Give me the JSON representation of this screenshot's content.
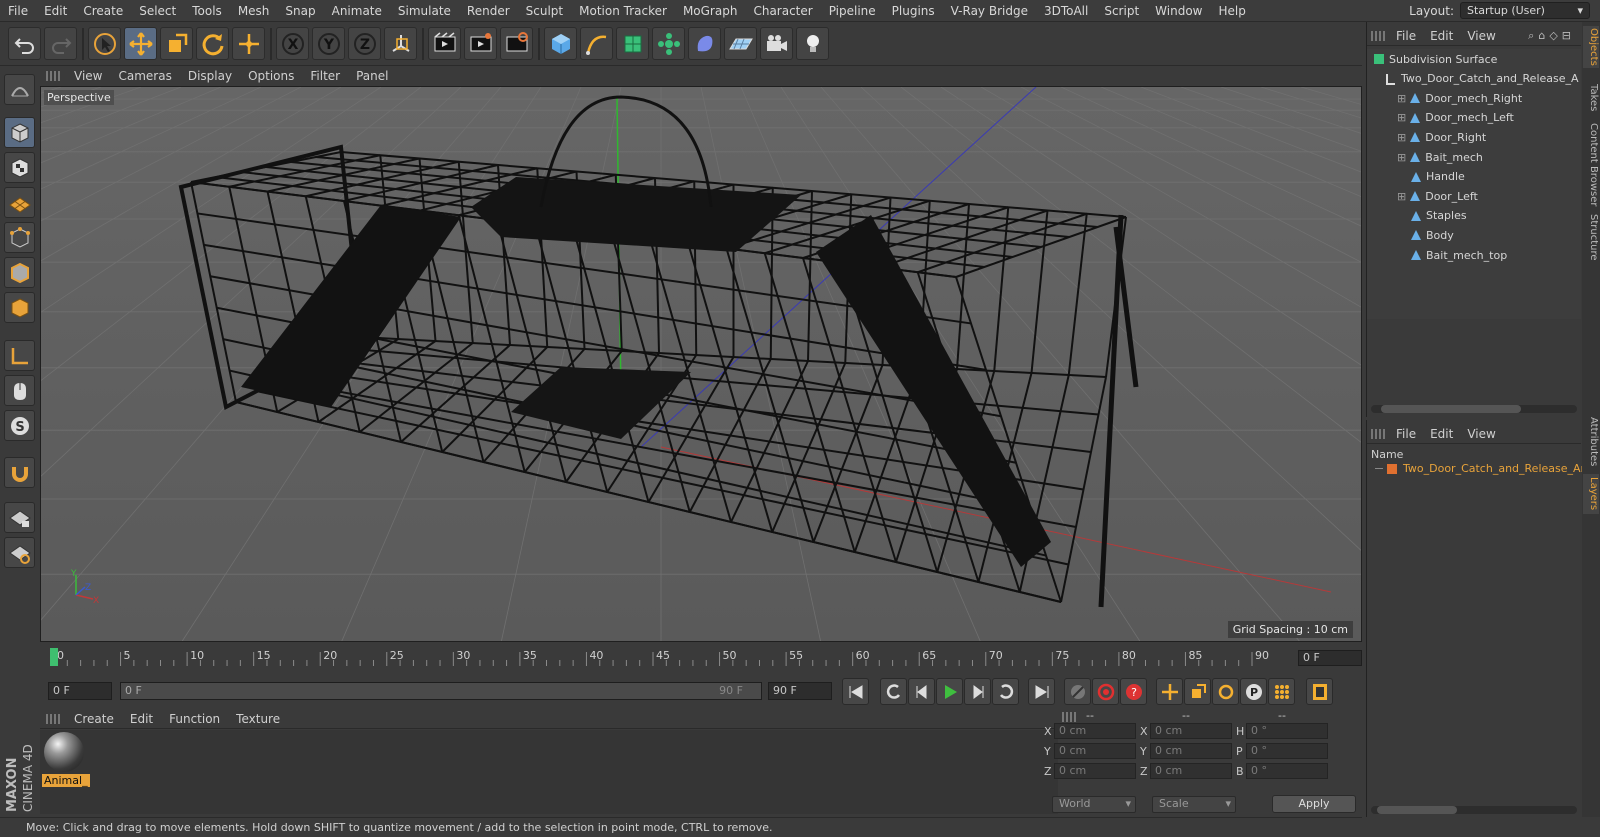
{
  "menubar": {
    "items": [
      "File",
      "Edit",
      "Create",
      "Select",
      "Tools",
      "Mesh",
      "Snap",
      "Animate",
      "Simulate",
      "Render",
      "Sculpt",
      "Motion Tracker",
      "MoGraph",
      "Character",
      "Pipeline",
      "Plugins",
      "V-Ray Bridge",
      "3DToAll",
      "Script",
      "Window",
      "Help"
    ],
    "layout_label": "Layout:",
    "layout_value": "Startup (User)"
  },
  "viewport": {
    "menu": [
      "View",
      "Cameras",
      "Display",
      "Options",
      "Filter",
      "Panel"
    ],
    "camera_label": "Perspective",
    "grid_spacing": "Grid Spacing : 10 cm",
    "axis_labels": [
      "Y",
      "Z",
      "X"
    ]
  },
  "timeline": {
    "ticks": [
      "0",
      "5",
      "10",
      "15",
      "20",
      "25",
      "30",
      "35",
      "40",
      "45",
      "50",
      "55",
      "60",
      "65",
      "70",
      "75",
      "80",
      "85",
      "90"
    ],
    "current_frame": "0 F"
  },
  "transport": {
    "start_field": "0 F",
    "range_start": "0 F",
    "range_end": "90 F",
    "end_field": "90 F"
  },
  "material_manager": {
    "menu": [
      "Create",
      "Edit",
      "Function",
      "Texture"
    ],
    "material_name": "Animal_"
  },
  "coordinates": {
    "headers": [
      "--",
      "--",
      "--"
    ],
    "rows": [
      {
        "a": "X",
        "av": "0 cm",
        "b": "X",
        "bv": "0 cm",
        "c": "H",
        "cv": "0 °"
      },
      {
        "a": "Y",
        "av": "0 cm",
        "b": "Y",
        "bv": "0 cm",
        "c": "P",
        "cv": "0 °"
      },
      {
        "a": "Z",
        "av": "0 cm",
        "b": "Z",
        "bv": "0 cm",
        "c": "B",
        "cv": "0 °"
      }
    ],
    "mode_select": "World",
    "scale_select": "Scale",
    "apply": "Apply"
  },
  "statusbar": {
    "text": "Move: Click and drag to move elements. Hold down SHIFT to quantize movement / add to the selection in point mode, CTRL to remove."
  },
  "object_manager": {
    "menu": [
      "File",
      "Edit",
      "View"
    ],
    "objects": [
      {
        "name": "Subdivision Surface",
        "depth": 0
      },
      {
        "name": "Two_Door_Catch_and_Release_A",
        "depth": 1
      },
      {
        "name": "Door_mech_Right",
        "depth": 2
      },
      {
        "name": "Door_mech_Left",
        "depth": 2
      },
      {
        "name": "Door_Right",
        "depth": 2
      },
      {
        "name": "Bait_mech",
        "depth": 2
      },
      {
        "name": "Handle",
        "depth": 2
      },
      {
        "name": "Door_Left",
        "depth": 2
      },
      {
        "name": "Staples",
        "depth": 2
      },
      {
        "name": "Body",
        "depth": 2
      },
      {
        "name": "Bait_mech_top",
        "depth": 2
      }
    ]
  },
  "layer_manager": {
    "menu": [
      "File",
      "Edit",
      "View"
    ],
    "name_header": "Name",
    "layer_name": "Two_Door_Catch_and_Release_Ar"
  },
  "right_tabs": [
    "Objects",
    "Takes",
    "Content Browser",
    "Structure",
    "Attributes",
    "Layers"
  ],
  "logo": {
    "line1": "MAXON",
    "line2": "CINEMA 4D"
  },
  "colors": {
    "accent": "#e8a33a",
    "active_tool": "#5a6c84",
    "play_green": "#3fbf3f"
  }
}
